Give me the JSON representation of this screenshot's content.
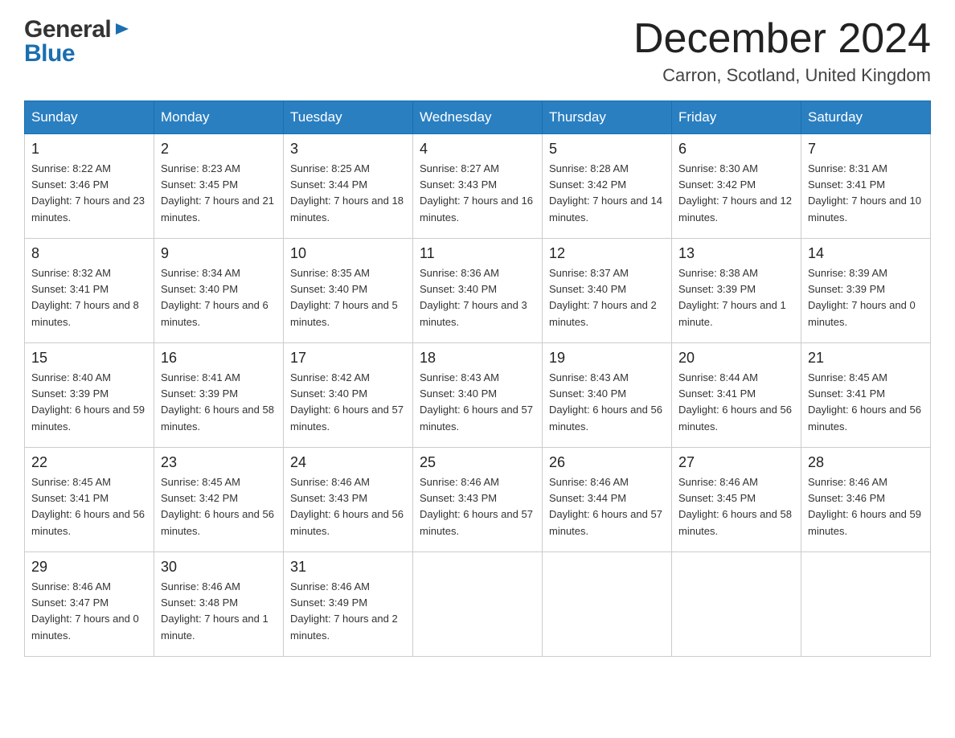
{
  "header": {
    "title": "December 2024",
    "subtitle": "Carron, Scotland, United Kingdom"
  },
  "logo": {
    "general": "General",
    "blue": "Blue"
  },
  "days_of_week": [
    "Sunday",
    "Monday",
    "Tuesday",
    "Wednesday",
    "Thursday",
    "Friday",
    "Saturday"
  ],
  "weeks": [
    [
      {
        "day": "1",
        "sunrise": "8:22 AM",
        "sunset": "3:46 PM",
        "daylight": "7 hours and 23 minutes."
      },
      {
        "day": "2",
        "sunrise": "8:23 AM",
        "sunset": "3:45 PM",
        "daylight": "7 hours and 21 minutes."
      },
      {
        "day": "3",
        "sunrise": "8:25 AM",
        "sunset": "3:44 PM",
        "daylight": "7 hours and 18 minutes."
      },
      {
        "day": "4",
        "sunrise": "8:27 AM",
        "sunset": "3:43 PM",
        "daylight": "7 hours and 16 minutes."
      },
      {
        "day": "5",
        "sunrise": "8:28 AM",
        "sunset": "3:42 PM",
        "daylight": "7 hours and 14 minutes."
      },
      {
        "day": "6",
        "sunrise": "8:30 AM",
        "sunset": "3:42 PM",
        "daylight": "7 hours and 12 minutes."
      },
      {
        "day": "7",
        "sunrise": "8:31 AM",
        "sunset": "3:41 PM",
        "daylight": "7 hours and 10 minutes."
      }
    ],
    [
      {
        "day": "8",
        "sunrise": "8:32 AM",
        "sunset": "3:41 PM",
        "daylight": "7 hours and 8 minutes."
      },
      {
        "day": "9",
        "sunrise": "8:34 AM",
        "sunset": "3:40 PM",
        "daylight": "7 hours and 6 minutes."
      },
      {
        "day": "10",
        "sunrise": "8:35 AM",
        "sunset": "3:40 PM",
        "daylight": "7 hours and 5 minutes."
      },
      {
        "day": "11",
        "sunrise": "8:36 AM",
        "sunset": "3:40 PM",
        "daylight": "7 hours and 3 minutes."
      },
      {
        "day": "12",
        "sunrise": "8:37 AM",
        "sunset": "3:40 PM",
        "daylight": "7 hours and 2 minutes."
      },
      {
        "day": "13",
        "sunrise": "8:38 AM",
        "sunset": "3:39 PM",
        "daylight": "7 hours and 1 minute."
      },
      {
        "day": "14",
        "sunrise": "8:39 AM",
        "sunset": "3:39 PM",
        "daylight": "7 hours and 0 minutes."
      }
    ],
    [
      {
        "day": "15",
        "sunrise": "8:40 AM",
        "sunset": "3:39 PM",
        "daylight": "6 hours and 59 minutes."
      },
      {
        "day": "16",
        "sunrise": "8:41 AM",
        "sunset": "3:39 PM",
        "daylight": "6 hours and 58 minutes."
      },
      {
        "day": "17",
        "sunrise": "8:42 AM",
        "sunset": "3:40 PM",
        "daylight": "6 hours and 57 minutes."
      },
      {
        "day": "18",
        "sunrise": "8:43 AM",
        "sunset": "3:40 PM",
        "daylight": "6 hours and 57 minutes."
      },
      {
        "day": "19",
        "sunrise": "8:43 AM",
        "sunset": "3:40 PM",
        "daylight": "6 hours and 56 minutes."
      },
      {
        "day": "20",
        "sunrise": "8:44 AM",
        "sunset": "3:41 PM",
        "daylight": "6 hours and 56 minutes."
      },
      {
        "day": "21",
        "sunrise": "8:45 AM",
        "sunset": "3:41 PM",
        "daylight": "6 hours and 56 minutes."
      }
    ],
    [
      {
        "day": "22",
        "sunrise": "8:45 AM",
        "sunset": "3:41 PM",
        "daylight": "6 hours and 56 minutes."
      },
      {
        "day": "23",
        "sunrise": "8:45 AM",
        "sunset": "3:42 PM",
        "daylight": "6 hours and 56 minutes."
      },
      {
        "day": "24",
        "sunrise": "8:46 AM",
        "sunset": "3:43 PM",
        "daylight": "6 hours and 56 minutes."
      },
      {
        "day": "25",
        "sunrise": "8:46 AM",
        "sunset": "3:43 PM",
        "daylight": "6 hours and 57 minutes."
      },
      {
        "day": "26",
        "sunrise": "8:46 AM",
        "sunset": "3:44 PM",
        "daylight": "6 hours and 57 minutes."
      },
      {
        "day": "27",
        "sunrise": "8:46 AM",
        "sunset": "3:45 PM",
        "daylight": "6 hours and 58 minutes."
      },
      {
        "day": "28",
        "sunrise": "8:46 AM",
        "sunset": "3:46 PM",
        "daylight": "6 hours and 59 minutes."
      }
    ],
    [
      {
        "day": "29",
        "sunrise": "8:46 AM",
        "sunset": "3:47 PM",
        "daylight": "7 hours and 0 minutes."
      },
      {
        "day": "30",
        "sunrise": "8:46 AM",
        "sunset": "3:48 PM",
        "daylight": "7 hours and 1 minute."
      },
      {
        "day": "31",
        "sunrise": "8:46 AM",
        "sunset": "3:49 PM",
        "daylight": "7 hours and 2 minutes."
      },
      null,
      null,
      null,
      null
    ]
  ]
}
